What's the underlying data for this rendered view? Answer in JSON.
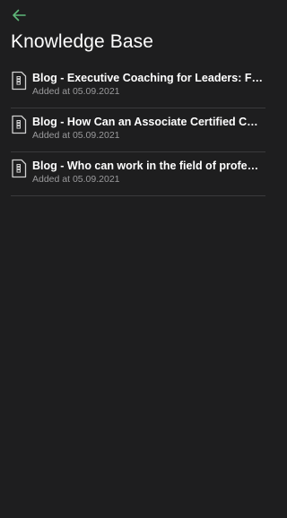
{
  "header": {
    "back_icon": "arrow-left-icon",
    "title": "Knowledge Base"
  },
  "colors": {
    "background": "#1e1e1f",
    "accent": "#5fb87a",
    "divider": "#3a3a3c",
    "subtext": "#9a9a9c"
  },
  "items": [
    {
      "icon": "document-icon",
      "title": "Blog - Executive Coaching for Leaders: Focusing on Long-Term Growth",
      "subtitle": "Added at 05.09.2021"
    },
    {
      "icon": "document-icon",
      "title": "Blog - How Can an Associate Certified Coach Help You",
      "subtitle": "Added at 05.09.2021"
    },
    {
      "icon": "document-icon",
      "title": "Blog - Who can work in the field of professional coaching",
      "subtitle": "Added at 05.09.2021"
    }
  ]
}
